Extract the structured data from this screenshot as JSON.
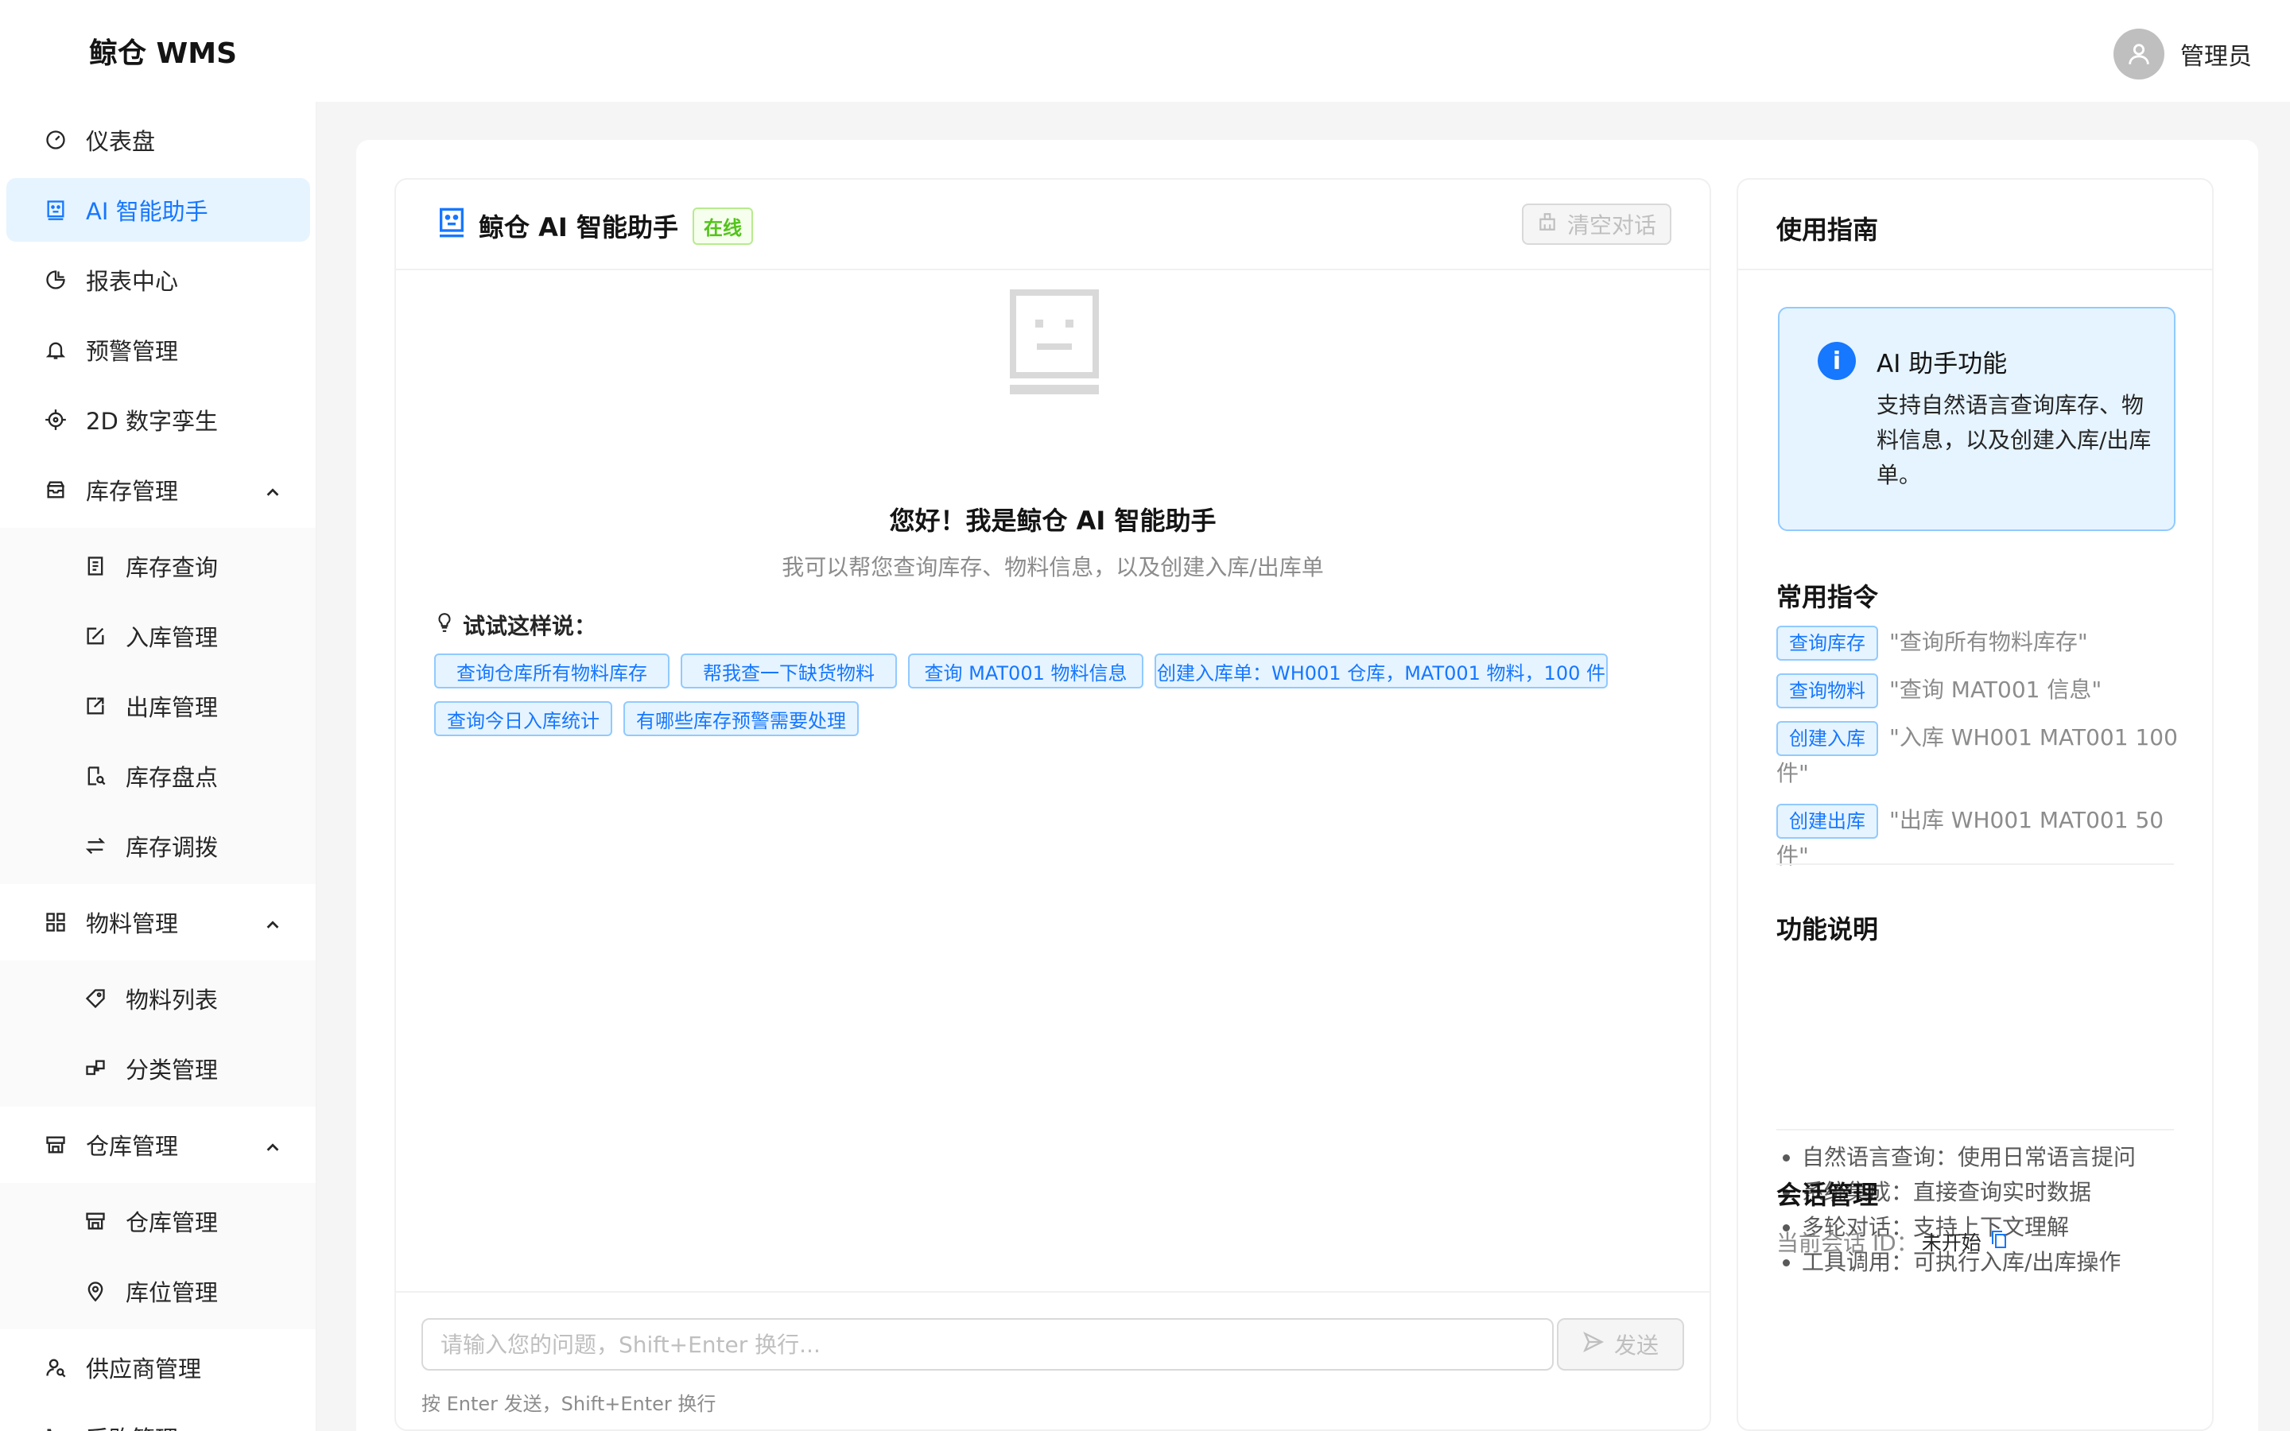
{
  "app": {
    "logo": "鲸仓 WMS",
    "user_name": "管理员"
  },
  "sidebar": {
    "items": [
      {
        "label": "仪表盘"
      },
      {
        "label": "AI 智能助手"
      },
      {
        "label": "报表中心"
      },
      {
        "label": "预警管理"
      },
      {
        "label": "2D 数字孪生"
      },
      {
        "label": "库存管理"
      },
      {
        "label": "库存查询"
      },
      {
        "label": "入库管理"
      },
      {
        "label": "出库管理"
      },
      {
        "label": "库存盘点"
      },
      {
        "label": "库存调拨"
      },
      {
        "label": "物料管理"
      },
      {
        "label": "物料列表"
      },
      {
        "label": "分类管理"
      },
      {
        "label": "仓库管理"
      },
      {
        "label": "仓库管理"
      },
      {
        "label": "库位管理"
      },
      {
        "label": "供应商管理"
      },
      {
        "label": "采购管理"
      }
    ]
  },
  "chat": {
    "title": "鲸仓 AI 智能助手",
    "status": "在线",
    "clear_label": "清空对话",
    "greeting_title": "您好！我是鲸仓 AI 智能助手",
    "greeting_sub": "我可以帮您查询库存、物料信息，以及创建入库/出库单",
    "try_label": "试试这样说：",
    "suggestions": [
      "查询仓库所有物料库存",
      "帮我查一下缺货物料",
      "查询 MAT001 物料信息",
      "创建入库单：WH001 仓库，MAT001 物料，100 件",
      "查询今日入库统计",
      "有哪些库存预警需要处理"
    ],
    "input_placeholder": "请输入您的问题，Shift+Enter 换行...",
    "send_label": "发送",
    "hint": "按 Enter 发送，Shift+Enter 换行"
  },
  "guide": {
    "title": "使用指南",
    "info_title": "AI 助手功能",
    "info_text": "支持自然语言查询库存、物料信息，以及创建入库/出库单。",
    "commands_title": "常用指令",
    "commands": [
      {
        "tag": "查询库存",
        "text": "\"查询所有物料库存\""
      },
      {
        "tag": "查询物料",
        "text": "\"查询 MAT001 信息\""
      },
      {
        "tag": "创建入库",
        "text": "\"入库 WH001 MAT001 100 件\""
      },
      {
        "tag": "创建出库",
        "text": "\"出库 WH001 MAT001 50件\""
      }
    ],
    "features_title": "功能说明",
    "features": [
      "自然语言查询：使用日常语言提问",
      "系统集成：直接查询实时数据",
      "多轮对话：支持上下文理解",
      "工具调用：可执行入库/出库操作"
    ],
    "session_title": "会话管理",
    "session_label": "当前会话 ID：",
    "session_value": "未开始"
  },
  "colors": {
    "primary": "#1677ff",
    "success": "#52c41a",
    "bg": "#f5f5f5"
  }
}
